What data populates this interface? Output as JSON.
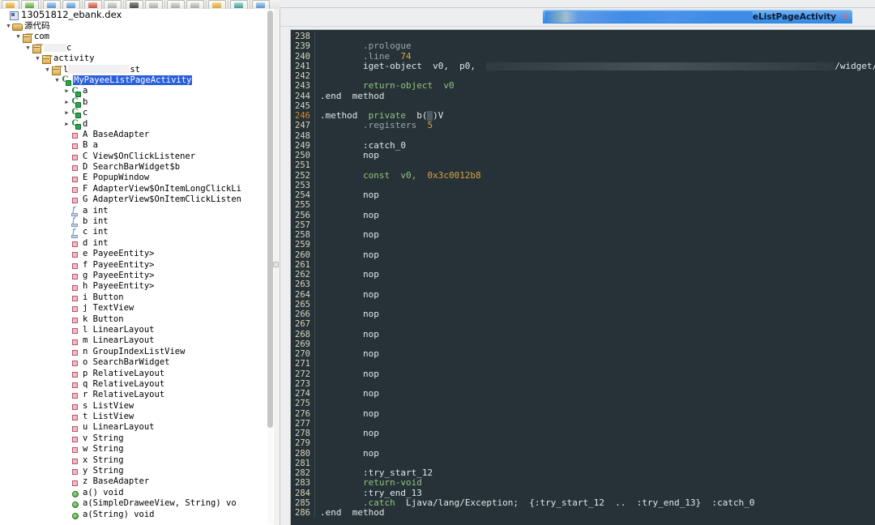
{
  "toolbar": {
    "groups": [
      {
        "buttons": [
          {
            "name": "open-file-button",
            "glyph": "g-yellow"
          },
          {
            "name": "save-button",
            "glyph": "g-green"
          }
        ]
      },
      {
        "buttons": [
          {
            "name": "undo-button",
            "glyph": "g-blue"
          },
          {
            "name": "redo-button",
            "glyph": "g-blue"
          }
        ]
      },
      {
        "buttons": [
          {
            "name": "cut-button",
            "glyph": "g-red"
          },
          {
            "name": "copy-button",
            "glyph": "g-gray"
          }
        ]
      },
      {
        "buttons": [
          {
            "name": "search-button",
            "glyph": "g-dark"
          },
          {
            "name": "search-dropdown-button",
            "glyph": "g-gray"
          }
        ]
      },
      {
        "buttons": [
          {
            "name": "navigate-back-button",
            "glyph": "g-gray"
          },
          {
            "name": "navigate-forward-button",
            "glyph": "g-gray"
          }
        ]
      },
      {
        "buttons": [
          {
            "name": "export-button",
            "glyph": "g-yellow"
          }
        ]
      },
      {
        "buttons": [
          {
            "name": "settings-button",
            "glyph": "g-teal"
          }
        ]
      },
      {
        "buttons": [
          {
            "name": "help-button",
            "glyph": "g-blue"
          }
        ]
      }
    ]
  },
  "tree": {
    "root_label": "13051812_ebank.dex",
    "rows": [
      {
        "indent": 0,
        "twisty": "down",
        "icon": "ico-src",
        "label": "源代码"
      },
      {
        "indent": 1,
        "twisty": "down",
        "icon": "ico-pkg",
        "label": "com"
      },
      {
        "indent": 2,
        "twisty": "down",
        "icon": "ico-pkg",
        "label": "",
        "redact": 28,
        "label_after": "c"
      },
      {
        "indent": 3,
        "twisty": "down",
        "icon": "ico-pkg",
        "label": "activity"
      },
      {
        "indent": 4,
        "twisty": "down",
        "icon": "ico-pkg",
        "label": "",
        "redact_pink": 76,
        "label_pre": "l",
        "label_after": "st"
      },
      {
        "indent": 5,
        "twisty": "down",
        "icon": "ico-cls",
        "label": "MyPayeeListPageActivity",
        "selected": true
      },
      {
        "indent": 6,
        "twisty": "right",
        "icon": "ico-cls",
        "label": "a"
      },
      {
        "indent": 6,
        "twisty": "right",
        "icon": "ico-cls",
        "label": "b"
      },
      {
        "indent": 6,
        "twisty": "right",
        "icon": "ico-cls",
        "label": "c"
      },
      {
        "indent": 6,
        "twisty": "right",
        "icon": "ico-cls",
        "label": "d"
      },
      {
        "indent": 6,
        "twisty": "none",
        "icon": "ico-inner",
        "label": "A   BaseAdapter"
      },
      {
        "indent": 6,
        "twisty": "none",
        "icon": "ico-inner",
        "label": "B   a"
      },
      {
        "indent": 6,
        "twisty": "none",
        "icon": "ico-inner",
        "label": "C   View$OnClickListener"
      },
      {
        "indent": 6,
        "twisty": "none",
        "icon": "ico-inner",
        "label": "D   SearchBarWidget$b"
      },
      {
        "indent": 6,
        "twisty": "none",
        "icon": "ico-inner",
        "label": "E   PopupWindow"
      },
      {
        "indent": 6,
        "twisty": "none",
        "icon": "ico-inner",
        "label": "F   AdapterView$OnItemLongClickLi"
      },
      {
        "indent": 6,
        "twisty": "none",
        "icon": "ico-inner",
        "label": "G   AdapterView$OnItemClickListen"
      },
      {
        "indent": 6,
        "twisty": "none",
        "icon": "ico-field",
        "label": "a   int"
      },
      {
        "indent": 6,
        "twisty": "none",
        "icon": "ico-field",
        "label": "b   int"
      },
      {
        "indent": 6,
        "twisty": "none",
        "icon": "ico-field",
        "label": "c   int"
      },
      {
        "indent": 6,
        "twisty": "none",
        "icon": "ico-inner",
        "label": "d   int"
      },
      {
        "indent": 6,
        "twisty": "none",
        "icon": "ico-inner",
        "label": "e   PayeeEntity>"
      },
      {
        "indent": 6,
        "twisty": "none",
        "icon": "ico-inner",
        "label": "f   PayeeEntity>"
      },
      {
        "indent": 6,
        "twisty": "none",
        "icon": "ico-inner",
        "label": "g   PayeeEntity>"
      },
      {
        "indent": 6,
        "twisty": "none",
        "icon": "ico-inner",
        "label": "h   PayeeEntity>"
      },
      {
        "indent": 6,
        "twisty": "none",
        "icon": "ico-inner",
        "label": "i   Button"
      },
      {
        "indent": 6,
        "twisty": "none",
        "icon": "ico-inner",
        "label": "j   TextView"
      },
      {
        "indent": 6,
        "twisty": "none",
        "icon": "ico-inner",
        "label": "k   Button"
      },
      {
        "indent": 6,
        "twisty": "none",
        "icon": "ico-inner",
        "label": "l   LinearLayout"
      },
      {
        "indent": 6,
        "twisty": "none",
        "icon": "ico-inner",
        "label": "m   LinearLayout"
      },
      {
        "indent": 6,
        "twisty": "none",
        "icon": "ico-inner",
        "label": "n   GroupIndexListView"
      },
      {
        "indent": 6,
        "twisty": "none",
        "icon": "ico-inner",
        "label": "o   SearchBarWidget"
      },
      {
        "indent": 6,
        "twisty": "none",
        "icon": "ico-inner",
        "label": "p   RelativeLayout"
      },
      {
        "indent": 6,
        "twisty": "none",
        "icon": "ico-inner",
        "label": "q   RelativeLayout"
      },
      {
        "indent": 6,
        "twisty": "none",
        "icon": "ico-inner",
        "label": "r   RelativeLayout"
      },
      {
        "indent": 6,
        "twisty": "none",
        "icon": "ico-inner",
        "label": "s   ListView"
      },
      {
        "indent": 6,
        "twisty": "none",
        "icon": "ico-inner",
        "label": "t   ListView"
      },
      {
        "indent": 6,
        "twisty": "none",
        "icon": "ico-inner",
        "label": "u   LinearLayout"
      },
      {
        "indent": 6,
        "twisty": "none",
        "icon": "ico-inner",
        "label": "v   String"
      },
      {
        "indent": 6,
        "twisty": "none",
        "icon": "ico-inner",
        "label": "w   String"
      },
      {
        "indent": 6,
        "twisty": "none",
        "icon": "ico-inner",
        "label": "x   String"
      },
      {
        "indent": 6,
        "twisty": "none",
        "icon": "ico-inner",
        "label": "y   String"
      },
      {
        "indent": 6,
        "twisty": "none",
        "icon": "ico-inner",
        "label": "z   BaseAdapter"
      },
      {
        "indent": 6,
        "twisty": "none",
        "icon": "ico-method",
        "label": "a()  void"
      },
      {
        "indent": 6,
        "twisty": "none",
        "icon": "ico-method",
        "label": "a(SimpleDraweeView,  String)  vo"
      },
      {
        "indent": 6,
        "twisty": "none",
        "icon": "ico-method",
        "label": "a(String)  void"
      }
    ]
  },
  "tab": {
    "name": "editor-tab",
    "visible_label": "eListPageActivity",
    "close_label": "✕"
  },
  "editor": {
    "first_line": 238,
    "current_line": 246,
    "lines": [
      {
        "n": 238,
        "parts": []
      },
      {
        "n": 239,
        "parts": [
          {
            "t": "        .prologue",
            "c": "k-dim"
          }
        ]
      },
      {
        "n": 240,
        "parts": [
          {
            "t": "        .line  ",
            "c": "k-dim"
          },
          {
            "t": "74",
            "c": "k-num"
          }
        ]
      },
      {
        "n": 241,
        "parts": [
          {
            "t": "        iget-object  v0,  p0,  ",
            "c": "k-white"
          },
          {
            "t": "REDACT:430",
            "c": "redact"
          },
          {
            "t": "/widget/TextView;",
            "c": "k-white"
          }
        ]
      },
      {
        "n": 242,
        "parts": []
      },
      {
        "n": 243,
        "parts": [
          {
            "t": "        return-object  v0",
            "c": "k-kw"
          }
        ]
      },
      {
        "n": 244,
        "parts": [
          {
            "t": ".end  method",
            "c": "k-white"
          }
        ]
      },
      {
        "n": 245,
        "parts": []
      },
      {
        "n": 246,
        "parts": [
          {
            "t": ".method  ",
            "c": "k-white"
          },
          {
            "t": "private",
            "c": "k-kw"
          },
          {
            "t": "  b(",
            "c": "k-white"
          },
          {
            "t": "CARET",
            "c": "caret"
          },
          {
            "t": ")V",
            "c": "k-white"
          }
        ]
      },
      {
        "n": 247,
        "parts": [
          {
            "t": "        .registers  ",
            "c": "k-dim"
          },
          {
            "t": "5",
            "c": "k-num"
          }
        ]
      },
      {
        "n": 248,
        "parts": []
      },
      {
        "n": 249,
        "parts": [
          {
            "t": "        :catch_0",
            "c": "k-white"
          }
        ]
      },
      {
        "n": 250,
        "parts": [
          {
            "t": "        nop",
            "c": "k-white"
          }
        ]
      },
      {
        "n": 251,
        "parts": []
      },
      {
        "n": 252,
        "parts": [
          {
            "t": "        const  v0,  ",
            "c": "k-kw"
          },
          {
            "t": "0x3c0012b8",
            "c": "k-num"
          }
        ]
      },
      {
        "n": 253,
        "parts": []
      },
      {
        "n": 254,
        "parts": [
          {
            "t": "        nop",
            "c": "k-white"
          }
        ]
      },
      {
        "n": 255,
        "parts": []
      },
      {
        "n": 256,
        "parts": [
          {
            "t": "        nop",
            "c": "k-white"
          }
        ]
      },
      {
        "n": 257,
        "parts": []
      },
      {
        "n": 258,
        "parts": [
          {
            "t": "        nop",
            "c": "k-white"
          }
        ]
      },
      {
        "n": 259,
        "parts": []
      },
      {
        "n": 260,
        "parts": [
          {
            "t": "        nop",
            "c": "k-white"
          }
        ]
      },
      {
        "n": 261,
        "parts": []
      },
      {
        "n": 262,
        "parts": [
          {
            "t": "        nop",
            "c": "k-white"
          }
        ]
      },
      {
        "n": 263,
        "parts": []
      },
      {
        "n": 264,
        "parts": [
          {
            "t": "        nop",
            "c": "k-white"
          }
        ]
      },
      {
        "n": 265,
        "parts": []
      },
      {
        "n": 266,
        "parts": [
          {
            "t": "        nop",
            "c": "k-white"
          }
        ]
      },
      {
        "n": 267,
        "parts": []
      },
      {
        "n": 268,
        "parts": [
          {
            "t": "        nop",
            "c": "k-white"
          }
        ]
      },
      {
        "n": 269,
        "parts": []
      },
      {
        "n": 270,
        "parts": [
          {
            "t": "        nop",
            "c": "k-white"
          }
        ]
      },
      {
        "n": 271,
        "parts": []
      },
      {
        "n": 272,
        "parts": [
          {
            "t": "        nop",
            "c": "k-white"
          }
        ]
      },
      {
        "n": 273,
        "parts": []
      },
      {
        "n": 274,
        "parts": [
          {
            "t": "        nop",
            "c": "k-white"
          }
        ]
      },
      {
        "n": 275,
        "parts": []
      },
      {
        "n": 276,
        "parts": [
          {
            "t": "        nop",
            "c": "k-white"
          }
        ]
      },
      {
        "n": 277,
        "parts": []
      },
      {
        "n": 278,
        "parts": [
          {
            "t": "        nop",
            "c": "k-white"
          }
        ]
      },
      {
        "n": 279,
        "parts": []
      },
      {
        "n": 280,
        "parts": [
          {
            "t": "        nop",
            "c": "k-white"
          }
        ]
      },
      {
        "n": 281,
        "parts": []
      },
      {
        "n": 282,
        "parts": [
          {
            "t": "        :try_start_12",
            "c": "k-white"
          }
        ]
      },
      {
        "n": 283,
        "parts": [
          {
            "t": "        return-void",
            "c": "k-kw"
          }
        ]
      },
      {
        "n": 284,
        "parts": [
          {
            "t": "        :try_end_13",
            "c": "k-white"
          }
        ]
      },
      {
        "n": 285,
        "parts": [
          {
            "t": "        ",
            "c": "k-white"
          },
          {
            "t": ".catch",
            "c": "k-kw"
          },
          {
            "t": "  Ljava/lang/Exception;  {:try_start_12  ..  :try_end_13}  :catch_0",
            "c": "k-white"
          }
        ]
      },
      {
        "n": 286,
        "parts": [
          {
            "t": ".end  method",
            "c": "k-white"
          }
        ]
      }
    ]
  },
  "colors": {
    "editor_bg": "#263238",
    "selection_blue": "#2a5fdb",
    "tab_blue": "#2f87e6",
    "current_line_num": "#d98b2b",
    "keyword_green": "#93c47d",
    "number_orange": "#d9a441"
  }
}
